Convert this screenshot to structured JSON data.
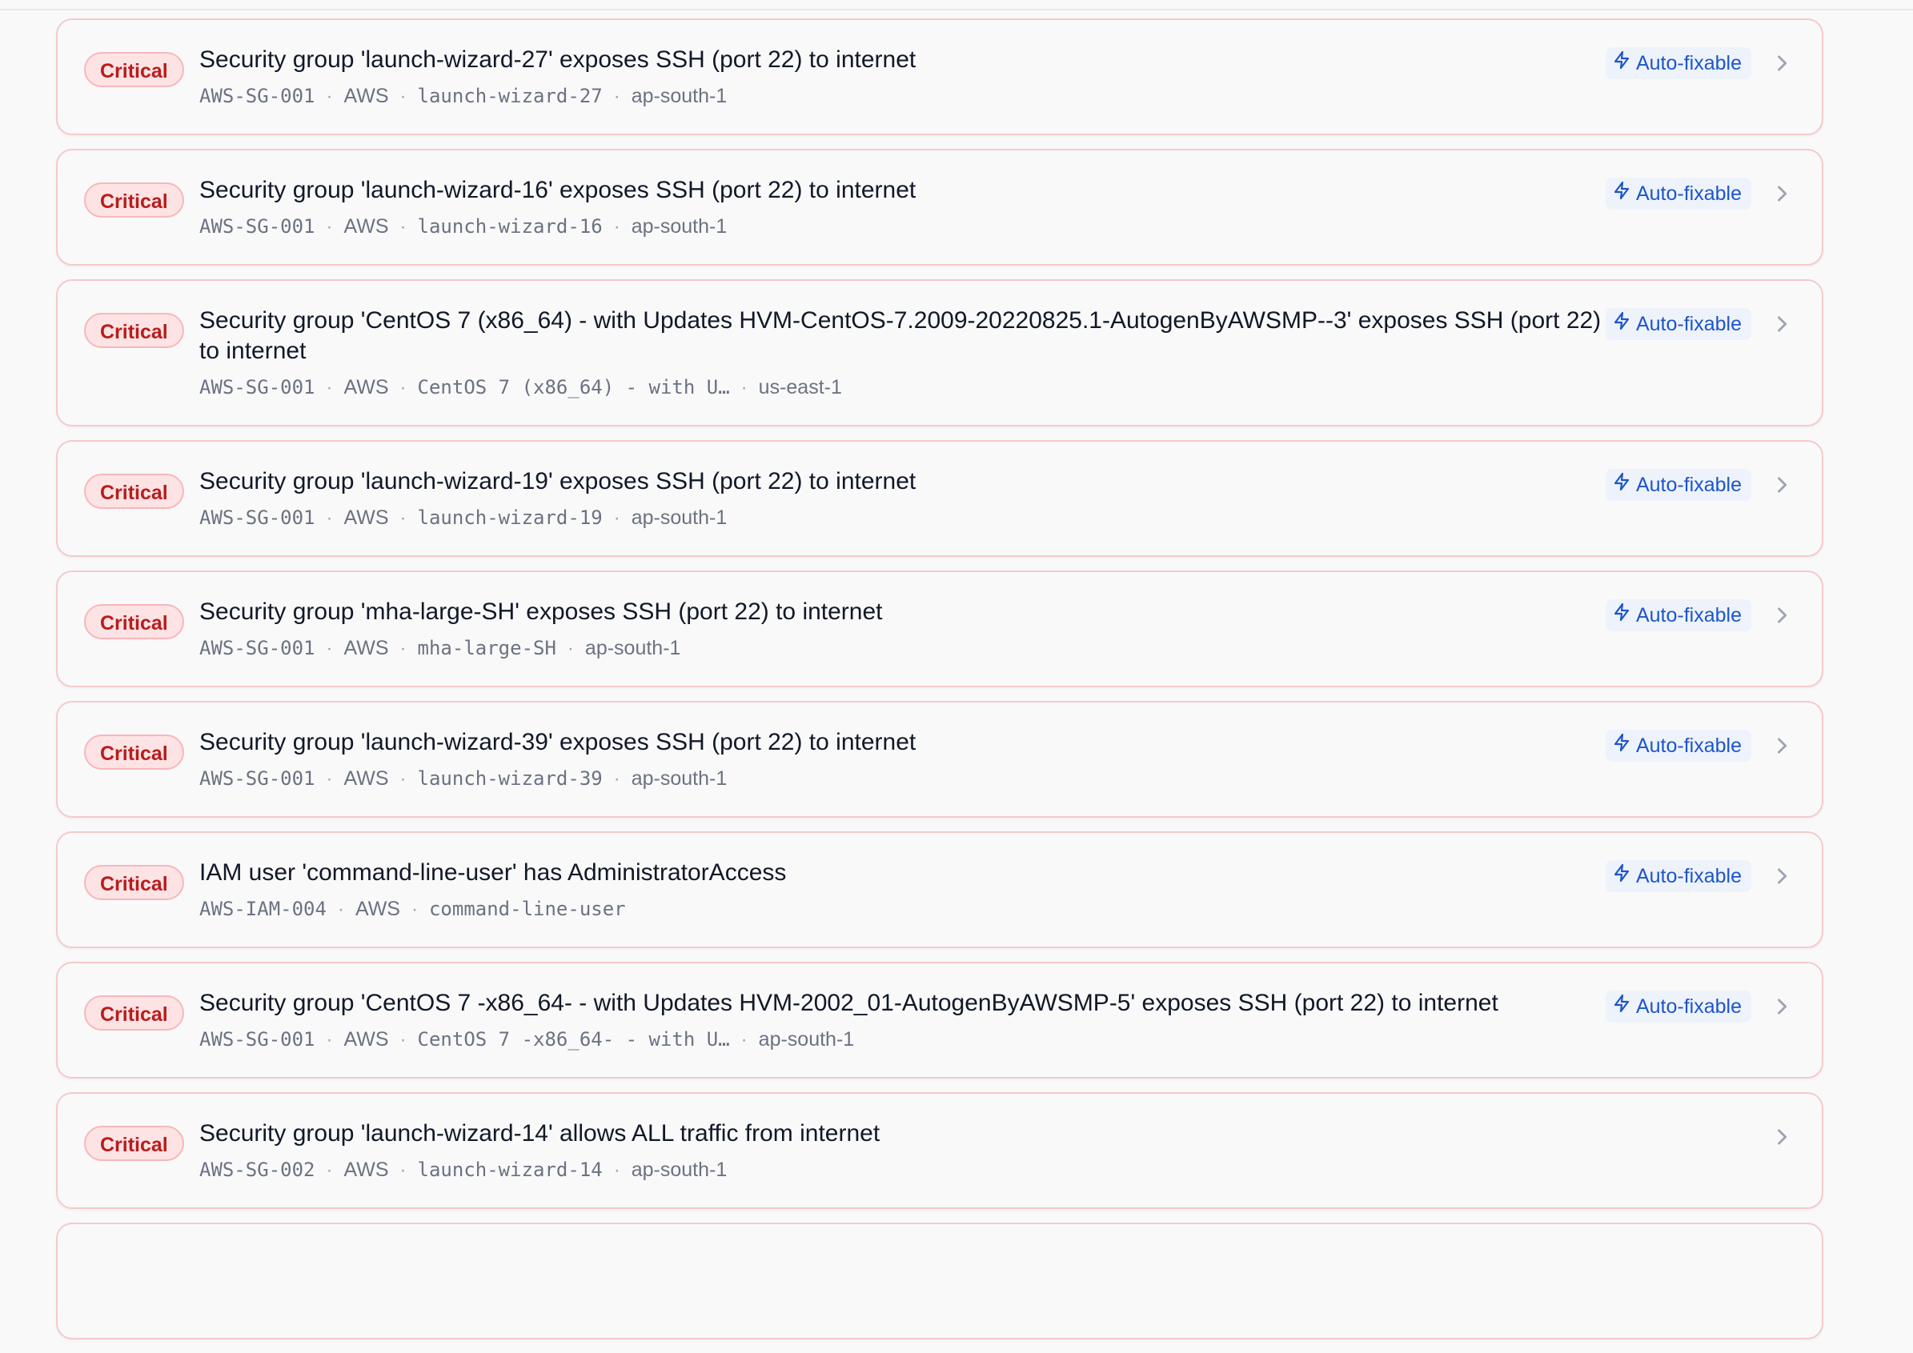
{
  "colors": {
    "critical_bg": "#fde3e4",
    "critical_text": "#b91c1c",
    "card_border": "#f6c9cc",
    "autofix_text": "#1d55c9",
    "autofix_bg": "#eef3fb",
    "meta_text": "#6b7280"
  },
  "icons": {
    "autofix": "lightning-bolt-icon",
    "open": "chevron-right-icon"
  },
  "findings": [
    {
      "severity": "Critical",
      "title": "Security group 'launch-wizard-27' exposes SSH (port 22) to internet",
      "rule_id": "AWS-SG-001",
      "provider": "AWS",
      "resource": "launch-wizard-27",
      "region": "ap-south-1",
      "autofix_label": "Auto-fixable"
    },
    {
      "severity": "Critical",
      "title": "Security group 'launch-wizard-16' exposes SSH (port 22) to internet",
      "rule_id": "AWS-SG-001",
      "provider": "AWS",
      "resource": "launch-wizard-16",
      "region": "ap-south-1",
      "autofix_label": "Auto-fixable"
    },
    {
      "severity": "Critical",
      "title": "Security group 'CentOS 7 (x86_64) - with Updates HVM-CentOS-7.2009-20220825.1-AutogenByAWSMP--3' exposes SSH (port 22) to internet",
      "rule_id": "AWS-SG-001",
      "provider": "AWS",
      "resource": "CentOS 7 (x86_64) - with U…",
      "region": "us-east-1",
      "autofix_label": "Auto-fixable"
    },
    {
      "severity": "Critical",
      "title": "Security group 'launch-wizard-19' exposes SSH (port 22) to internet",
      "rule_id": "AWS-SG-001",
      "provider": "AWS",
      "resource": "launch-wizard-19",
      "region": "ap-south-1",
      "autofix_label": "Auto-fixable"
    },
    {
      "severity": "Critical",
      "title": "Security group 'mha-large-SH' exposes SSH (port 22) to internet",
      "rule_id": "AWS-SG-001",
      "provider": "AWS",
      "resource": "mha-large-SH",
      "region": "ap-south-1",
      "autofix_label": "Auto-fixable"
    },
    {
      "severity": "Critical",
      "title": "Security group 'launch-wizard-39' exposes SSH (port 22) to internet",
      "rule_id": "AWS-SG-001",
      "provider": "AWS",
      "resource": "launch-wizard-39",
      "region": "ap-south-1",
      "autofix_label": "Auto-fixable"
    },
    {
      "severity": "Critical",
      "title": "IAM user 'command-line-user' has AdministratorAccess",
      "rule_id": "AWS-IAM-004",
      "provider": "AWS",
      "resource": "command-line-user",
      "region": "",
      "autofix_label": "Auto-fixable"
    },
    {
      "severity": "Critical",
      "title": "Security group 'CentOS 7 -x86_64- - with Updates HVM-2002_01-AutogenByAWSMP-5' exposes SSH (port 22) to internet",
      "rule_id": "AWS-SG-001",
      "provider": "AWS",
      "resource": "CentOS 7 -x86_64- - with U…",
      "region": "ap-south-1",
      "autofix_label": "Auto-fixable"
    },
    {
      "severity": "Critical",
      "title": "Security group 'launch-wizard-14' allows ALL traffic from internet",
      "rule_id": "AWS-SG-002",
      "provider": "AWS",
      "resource": "launch-wizard-14",
      "region": "ap-south-1",
      "autofix_label": ""
    }
  ]
}
